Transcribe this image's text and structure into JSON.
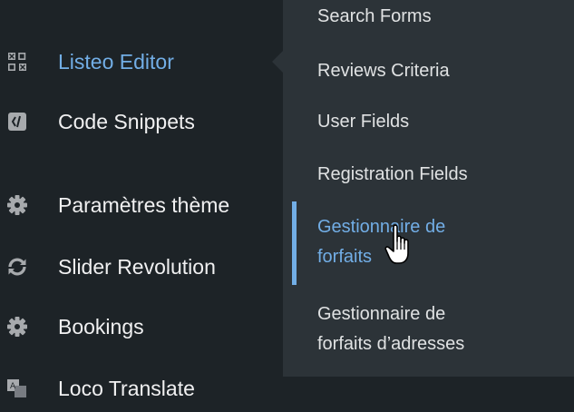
{
  "sidebar": {
    "items": [
      {
        "label": "Listeo Editor",
        "icon": "grid-icon",
        "active": true
      },
      {
        "label": "Code Snippets",
        "icon": "code-icon"
      },
      {
        "label": "Paramètres thème",
        "icon": "gear-icon"
      },
      {
        "label": "Slider Revolution",
        "icon": "refresh-icon"
      },
      {
        "label": "Bookings",
        "icon": "gear-icon"
      },
      {
        "label": "Loco Translate",
        "icon": "translate-icon"
      }
    ]
  },
  "submenu": {
    "items": [
      {
        "label": "Search Forms"
      },
      {
        "label": "Reviews Criteria"
      },
      {
        "label": "User Fields"
      },
      {
        "label": "Registration Fields"
      },
      {
        "line1": "Gestionnaire de",
        "line2": "forfaits",
        "current": true
      },
      {
        "line1": "Gestionnaire de",
        "line2": "forfaits d’adresses"
      }
    ]
  },
  "colors": {
    "sidebar_bg": "#1d2327",
    "submenu_bg": "#2c3338",
    "accent": "#72aee6",
    "text": "#f0f0f1",
    "icon": "#a7aaad"
  }
}
